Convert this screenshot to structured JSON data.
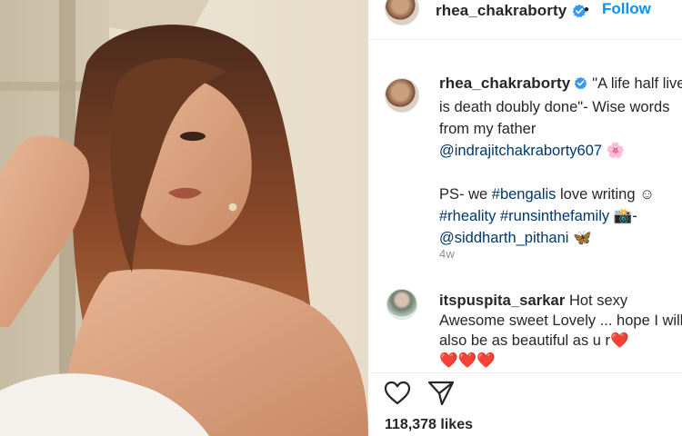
{
  "post_author": {
    "username": "rhea_chakraborty",
    "verified": true,
    "separator": "•",
    "follow_label": "Follow"
  },
  "caption": {
    "username": "rhea_chakraborty",
    "line1": "\"A life half lived",
    "line2": "is death doubly done\"- Wise words",
    "line3": "from my father",
    "mention1": "@indrajitchakraborty607",
    "emoji1": "🌸",
    "ps_text": "PS- we ",
    "tag_bengalis": "#bengalis",
    "ps_rest": " love writing ☺",
    "tag_rheality": "#rheality",
    "tag_runs": "#runsinthefamily",
    "emoji_camera": "📸-",
    "mention2": "@siddharth_pithani",
    "emoji2": "🦋",
    "time": "4w"
  },
  "comment": {
    "username": "itspuspita_sarkar",
    "text": " Hot sexy Awesome sweet Lovely ... hope I will also be as beautiful as u r",
    "hearts_inline": "❤️",
    "hearts_row": "❤️❤️❤️"
  },
  "actions": {
    "like_icon": "heart-outline-icon",
    "share_icon": "paper-plane-icon",
    "likes_label": "118,378 likes"
  },
  "colors": {
    "accent": "#0095f6",
    "tag": "#00376b",
    "muted": "#8e8e8e",
    "text": "#262626"
  }
}
